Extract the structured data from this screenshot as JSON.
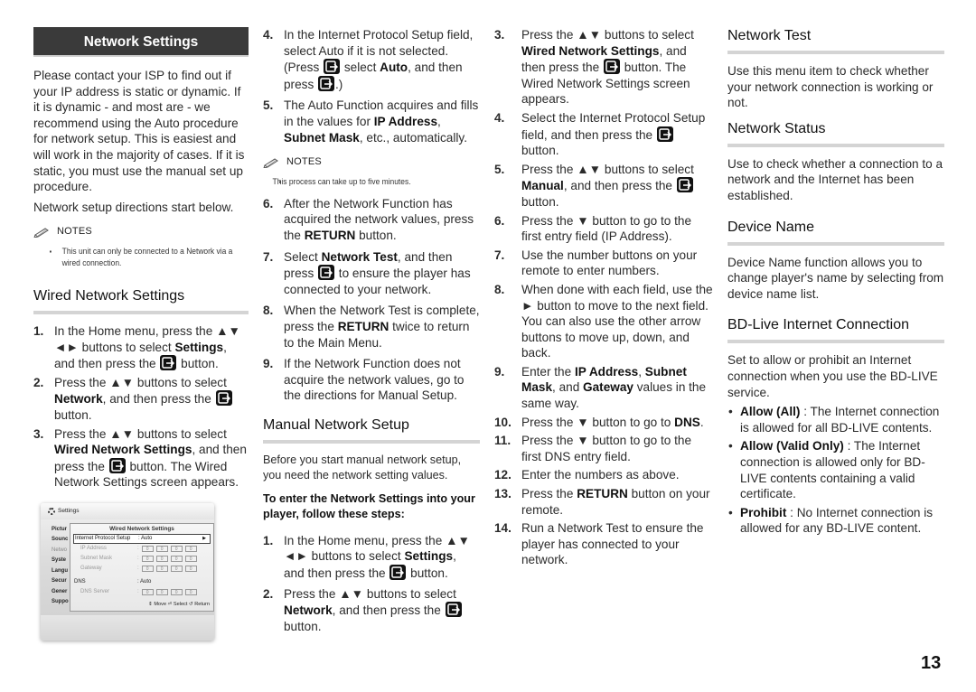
{
  "page_number": "13",
  "col1": {
    "banner": "Network Settings",
    "intro": "Please contact your ISP to find out if your IP address is static or dynamic. If it is dynamic - and most are - we recommend using the Auto procedure for network setup. This is easiest and will work in the majority of cases. If it is static, you must use the manual set up procedure.",
    "intro2": "Network setup directions start below.",
    "notes_title": "NOTES",
    "note": "This unit can only be connected to a Network via a wired connection.",
    "wired_heading": "Wired Network Settings",
    "steps": [
      {
        "num": "1.",
        "a": "In the Home menu, press the ▲▼ ◄► buttons to select ",
        "b": "Settings",
        "c": ", and then press the ",
        "d": " button."
      },
      {
        "num": "2.",
        "a": "Press the ▲▼ buttons to select ",
        "b": "Network",
        "c": ", and then press the ",
        "d": " button."
      },
      {
        "num": "3.",
        "a": "Press the ▲▼ buttons to select ",
        "b": "Wired Network Settings",
        "c": ", and then press the ",
        "d": " button. The Wired Network Settings screen appears."
      }
    ],
    "screen": {
      "title": "Settings",
      "menu": [
        "Pictur",
        "Sounc",
        "Netwo",
        "Syste",
        "Langu",
        "Secur",
        "Gener",
        "Suppo"
      ],
      "dialog_title": "Wired Network Settings",
      "rows": [
        {
          "label": "Internet Protocol Setup",
          "value": ": Auto"
        },
        {
          "label": "IP Address",
          "value": "0"
        },
        {
          "label": "Subnet Mask",
          "value": "0"
        },
        {
          "label": "Gateway",
          "value": "0"
        },
        {
          "label": "DNS",
          "value": ": Auto"
        },
        {
          "label": "DNS Server",
          "value": "0"
        }
      ],
      "footer": "⇕ Move  ⏎ Select  ↺ Return"
    }
  },
  "col2": {
    "steps_top": [
      {
        "num": "4.",
        "text1": "In the Internet Protocol Setup field, select Auto if it is not selected. (Press ",
        "text2": " select ",
        "bold": "Auto",
        "text3": ", and then press ",
        "text4": ".)"
      },
      {
        "num": "5.",
        "a": "The Auto Function acquires and fills in the values for ",
        "b1": "IP Address",
        "c": ", ",
        "b2": "Subnet Mask",
        "d": ", etc., automatically."
      }
    ],
    "notes_title": "NOTES",
    "note": "This process can take up to five minutes.",
    "steps_mid": [
      {
        "num": "6.",
        "a": "After the Network Function has acquired the network values, press the ",
        "b": "RETURN",
        "c": " button."
      },
      {
        "num": "7.",
        "a": "Select ",
        "b": "Network Test",
        "c": ", and then press ",
        "d": " to ensure the player has connected to your network."
      },
      {
        "num": "8.",
        "a": "When the Network Test is complete, press the ",
        "b": "RETURN",
        "c": " twice to return to the Main Menu."
      },
      {
        "num": "9.",
        "a": "If the Network Function does not acquire the network values, go to the directions for Manual Setup."
      }
    ],
    "manual_heading": "Manual Network Setup",
    "manual_intro": "Before you start manual network setup, you need the network setting values.",
    "manual_subhead": "To enter the Network Settings into your player, follow these steps:",
    "manual_steps": [
      {
        "num": "1.",
        "a": "In the Home menu, press the ▲▼ ◄► buttons to select ",
        "b": "Settings",
        "c": ", and then press the ",
        "d": " button."
      },
      {
        "num": "2.",
        "a": "Press the ▲▼ buttons to select ",
        "b": "Network",
        "c": ", and then press the ",
        "d": " button."
      }
    ]
  },
  "col3": {
    "steps": [
      {
        "num": "3.",
        "a": "Press the ▲▼ buttons to select ",
        "b": "Wired Network Settings",
        "c": ", and then press the ",
        "d": " button. The Wired Network Settings screen appears."
      },
      {
        "num": "4.",
        "a": "Select the Internet Protocol Setup field, and then press the ",
        "d": " button."
      },
      {
        "num": "5.",
        "a": "Press the ▲▼ buttons to select ",
        "b": "Manual",
        "c": ", and then press the ",
        "d": " button."
      },
      {
        "num": "6.",
        "a": "Press the ▼ button to go to the first entry field (IP Address)."
      },
      {
        "num": "7.",
        "a": "Use the number buttons on your remote to enter numbers."
      },
      {
        "num": "8.",
        "a": "When done with each field, use the ► button to move to the next field. You can also use the other arrow buttons to move up, down, and back."
      },
      {
        "num": "9.",
        "a": "Enter the ",
        "b1": "IP Address",
        "c1": ", ",
        "b2": "Subnet Mask",
        "c2": ", and ",
        "b3": "Gateway",
        "c3": " values in the same way."
      },
      {
        "num": "10.",
        "a": "Press the ▼ button to go to ",
        "b": "DNS",
        "c": "."
      },
      {
        "num": "11.",
        "a": "Press the ▼ button to go to the first DNS entry field."
      },
      {
        "num": "12.",
        "a": "Enter the numbers as above."
      },
      {
        "num": "13.",
        "a": "Press the ",
        "b": "RETURN",
        "c": " button on your remote."
      },
      {
        "num": "14.",
        "a": "Run a Network Test to ensure the player has connected to your network."
      }
    ]
  },
  "col4": {
    "sections": [
      {
        "heading": "Network Test",
        "text": "Use this menu item to check whether your network connection is working or not."
      },
      {
        "heading": "Network Status",
        "text": "Use to check whether a connection to a network and the Internet has been established."
      },
      {
        "heading": "Device Name",
        "text": "Device Name function allows you to change player's name by selecting from device name list."
      },
      {
        "heading": "BD-Live Internet Connection",
        "text": "Set to allow or prohibit an Internet connection when you use the BD-LIVE service."
      }
    ],
    "bullets": [
      {
        "bold": "Allow (All)",
        "text": " : The Internet connection is allowed for all BD-LIVE contents."
      },
      {
        "bold": "Allow (Valid Only)",
        "text": " : The Internet connection is allowed only for BD-LIVE contents containing a valid certificate."
      },
      {
        "bold": "Prohibit",
        "text": " : No Internet connection is allowed for any BD-LIVE content."
      }
    ]
  }
}
